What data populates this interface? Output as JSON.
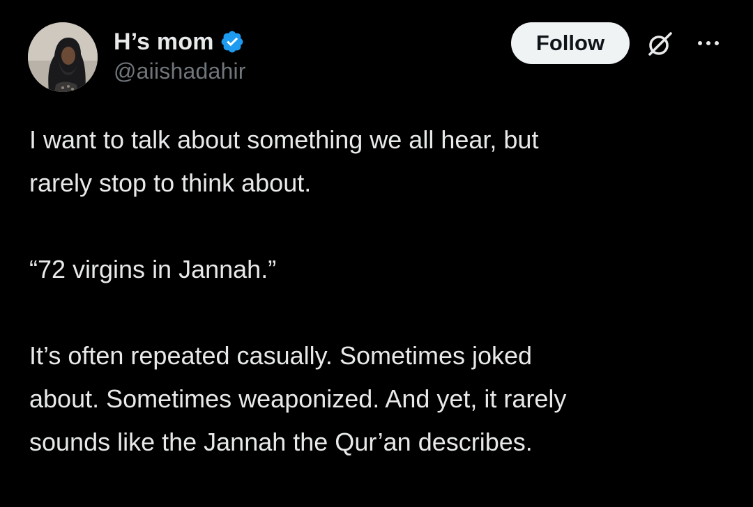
{
  "post": {
    "author": {
      "display_name": "H’s mom",
      "handle": "@aiishadahir",
      "verified": true
    },
    "actions": {
      "follow_label": "Follow",
      "grok_icon": "grok-icon",
      "more_icon": "more-icon"
    },
    "text": {
      "paragraph_1": "I want to talk about something we all hear, but\nrarely stop to think about.",
      "paragraph_2": "“72 virgins in Jannah.”",
      "paragraph_3": "It’s often repeated casually. Sometimes joked\nabout. Sometimes weaponized. And yet, it rarely\nsounds like the Jannah the Qur’an describes."
    }
  },
  "colors": {
    "background": "#000000",
    "text_primary": "#e7e9ea",
    "text_secondary": "#71767b",
    "verified_blue": "#1d9bf0",
    "follow_bg": "#eff3f4"
  }
}
